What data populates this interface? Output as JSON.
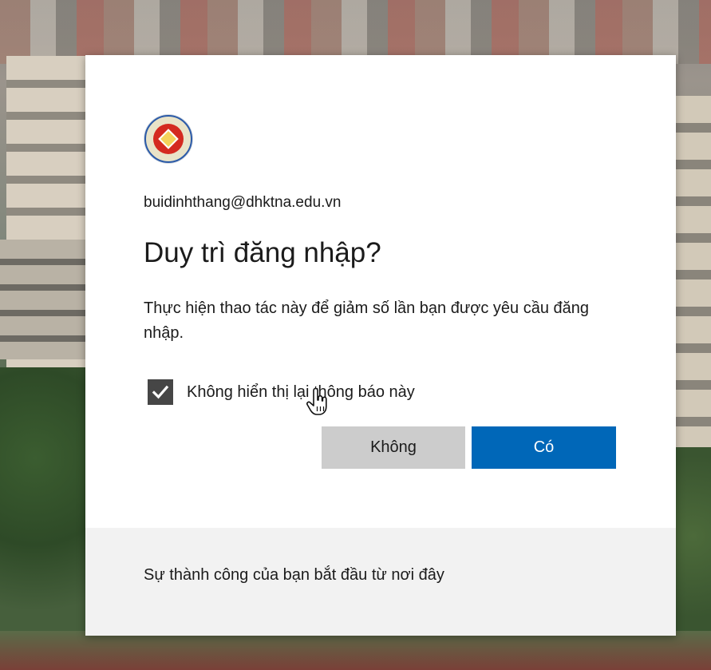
{
  "dialog": {
    "account_email": "buidinhthang@dhktna.edu.vn",
    "title": "Duy trì đăng nhập?",
    "description": "Thực hiện thao tác này để giảm số lần bạn được yêu cầu đăng nhập.",
    "checkbox": {
      "label": "Không hiển thị lại thông báo này",
      "checked": true,
      "icon": "checkmark-icon"
    },
    "buttons": {
      "no_label": "Không",
      "yes_label": "Có"
    },
    "footer_text": "Sự thành công của bạn bắt đầu từ nơi đây",
    "logo_icon": "university-seal"
  },
  "colors": {
    "primary_button": "#0067b8",
    "secondary_button": "#cccccc",
    "checkbox": "#464646",
    "footer_background": "#f2f2f2",
    "logo_red": "#d42a20"
  }
}
